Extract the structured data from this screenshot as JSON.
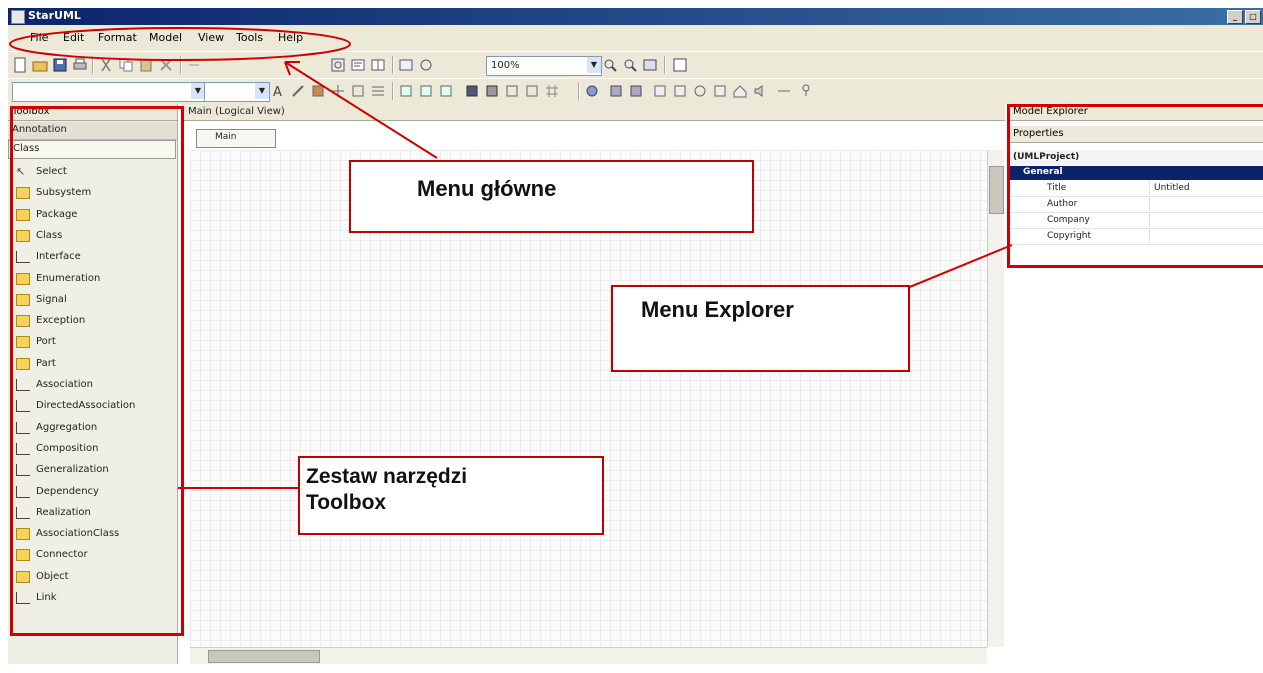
{
  "window": {
    "title": "StarUML"
  },
  "menubar": {
    "items": [
      "File",
      "Edit",
      "Format",
      "Model",
      "View",
      "Tools",
      "Help"
    ]
  },
  "toolbar": {
    "zoom_value": "100%"
  },
  "toolbox": {
    "title": "Toolbox",
    "section_annotation": "Annotation",
    "section_class": "Class",
    "items": [
      "Select",
      "Subsystem",
      "Package",
      "Class",
      "Interface",
      "Enumeration",
      "Signal",
      "Exception",
      "Port",
      "Part",
      "Association",
      "DirectedAssociation",
      "Aggregation",
      "Composition",
      "Generalization",
      "Dependency",
      "Realization",
      "AssociationClass",
      "Connector",
      "Object",
      "Link"
    ]
  },
  "editor": {
    "header": "Main (Logical View)",
    "tab_label": "Main"
  },
  "right_panel": {
    "model_explorer_title": "Model Explorer",
    "properties_title": "Properties",
    "selected_object": "(UMLProject)",
    "category": "General",
    "properties": [
      {
        "name": "Title",
        "value": "Untitled"
      },
      {
        "name": "Author",
        "value": ""
      },
      {
        "name": "Company",
        "value": ""
      },
      {
        "name": "Copyright",
        "value": ""
      }
    ]
  },
  "annotations": {
    "menu_main": "Menu główne",
    "menu_explorer": "Menu Explorer",
    "toolbox_line1": "Zestaw narzędzi",
    "toolbox_line2": "Toolbox"
  },
  "colors": {
    "annotation_red": "#d10000"
  }
}
